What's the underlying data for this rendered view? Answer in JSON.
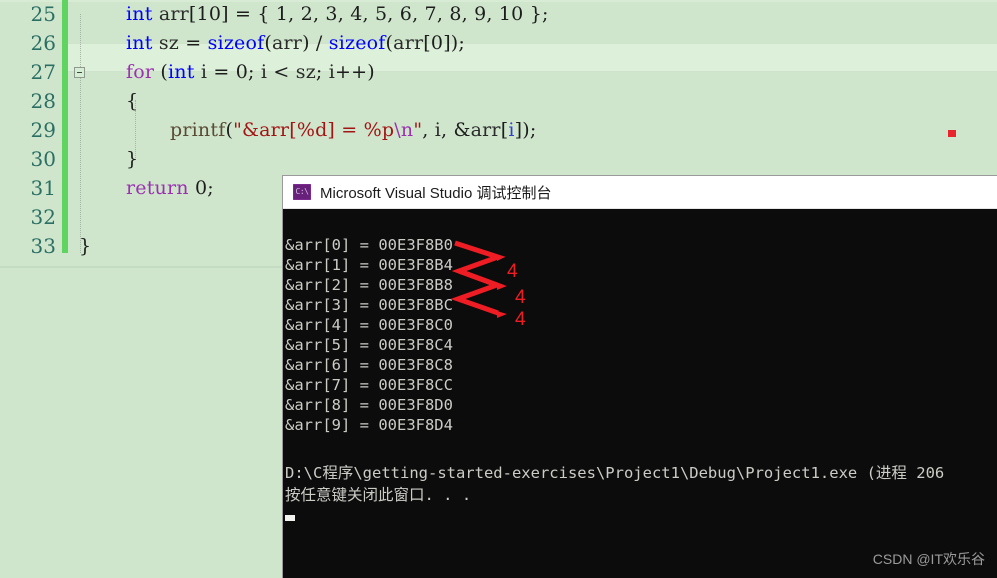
{
  "editor": {
    "first_visible_partial_line": "int arr[10] = { 1, 2, 3, 4, 5, 6, 7, 8, 9, 10 };",
    "lines": [
      {
        "number": "25",
        "text": "int arr[10] = { 1, 2, 3, 4, 5, 6, 7, 8, 9, 10 };"
      },
      {
        "number": "26",
        "text": "int sz = sizeof(arr) / sizeof(arr[0]);"
      },
      {
        "number": "27",
        "text": "for (int i = 0; i < sz; i++)"
      },
      {
        "number": "28",
        "text": "{"
      },
      {
        "number": "29",
        "text": "printf(\"&arr[%d] = %p\\n\", i, &arr[i]);"
      },
      {
        "number": "30",
        "text": "}"
      },
      {
        "number": "31",
        "text": "return 0;"
      },
      {
        "number": "32",
        "text": ""
      },
      {
        "number": "33",
        "text": "}"
      }
    ],
    "tokens": {
      "l25": [
        "int",
        " arr",
        "[",
        "10",
        "]",
        " = { ",
        "1, 2, 3, 4, 5, 6, 7, 8, 9, 10",
        " };"
      ],
      "l26_kw": "int",
      "l26_sizeof": "sizeof",
      "l27_kw": "for",
      "l29_fn": "printf",
      "l29_str": "\"&arr[%d] = %p",
      "l29_esc": "\\n",
      "l29_strend": "\"",
      "l31_kw": "return"
    },
    "current_line_number": "26",
    "marker_color": "#e8252a",
    "changebar_color": "#60d460",
    "keyword_color": "#0000ff",
    "control_keyword_color": "#9b30b0",
    "string_color": "#a31515",
    "background": "#cfe6cd"
  },
  "console": {
    "title": "Microsoft Visual Studio 调试控制台",
    "icon": "console-app-icon",
    "output_lines": [
      "&arr[0] = 00E3F8B0",
      "&arr[1] = 00E3F8B4",
      "&arr[2] = 00E3F8B8",
      "&arr[3] = 00E3F8BC",
      "&arr[4] = 00E3F8C0",
      "&arr[5] = 00E3F8C4",
      "&arr[6] = 00E3F8C8",
      "&arr[7] = 00E3F8CC",
      "&arr[8] = 00E3F8D0",
      "&arr[9] = 00E3F8D4"
    ],
    "exit_line": "D:\\C程序\\getting-started-exercises\\Project1\\Debug\\Project1.exe (进程 206",
    "prompt_line": "按任意键关闭此窗口. . .",
    "annotations": [
      {
        "label": "4"
      },
      {
        "label": "4"
      },
      {
        "label": "4"
      }
    ],
    "annotation_color": "#ee1c23",
    "background": "#0c0c0c",
    "text_color": "#ccccc7"
  },
  "watermark": {
    "text": "CSDN @IT欢乐谷"
  }
}
